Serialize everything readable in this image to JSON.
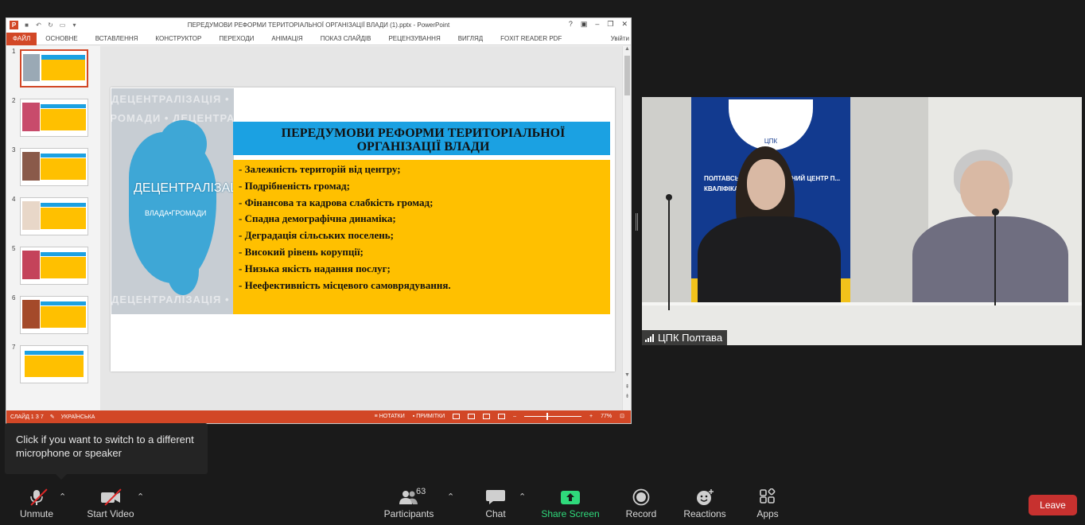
{
  "powerpoint": {
    "window_title": "ПЕРЕДУМОВИ РЕФОРМИ ТЕРИТОРІАЛЬНОЇ ОРГАНІЗАЦІЇ ВЛАДИ (1).pptx - PowerPoint",
    "window_controls": [
      "?",
      "▣",
      "–",
      "❐",
      "✕"
    ],
    "ribbon_tabs": [
      "ФАЙЛ",
      "ОСНОВНЕ",
      "ВСТАВЛЕННЯ",
      "КОНСТРУКТОР",
      "ПЕРЕХОДИ",
      "АНІМАЦІЯ",
      "ПОКАЗ СЛАЙДІВ",
      "РЕЦЕНЗУВАННЯ",
      "ВИГЛЯД",
      "FOXIT READER PDF"
    ],
    "sign_in": "Увійти",
    "thumbnails": [
      "1",
      "2",
      "3",
      "4",
      "5",
      "6",
      "7"
    ],
    "active_slide": 1,
    "slide": {
      "image_text": "ДЕЦЕНТРАЛІЗАЦІЯ",
      "image_subtext": "ВЛАДА•ГРОМАДИ",
      "title": "ПЕРЕДУМОВИ РЕФОРМИ ТЕРИТОРІАЛЬНОЇ ОРГАНІЗАЦІЇ ВЛАДИ",
      "bullets": [
        "- Залежність територій від центру;",
        "- Подрібненість громад;",
        "- Фінансова та кадрова слабкість громад;",
        "- Спадна демографічна динаміка;",
        "- Деградація сільських поселень;",
        "- Високий рівень корупції;",
        "- Низька якість надання послуг;",
        "- Неефективність місцевого самоврядування."
      ]
    },
    "status": {
      "slide_counter": "СЛАЙД 1 З 7",
      "language": "УКРАЇНСЬКА",
      "notes": "НОТАТКИ",
      "comments": "ПРИМІТКИ",
      "zoom": "77%"
    },
    "colors": {
      "accent": "#d24726",
      "title_band": "#1ba1e2",
      "body_fill": "#ffc000"
    }
  },
  "video": {
    "participant_name": "ЦПК Полтава",
    "emblem_text": "ЦПК",
    "banner_text": "ПОЛТАВСЬКИЙ РЕГІОНАЛЬНИЙ ЦЕНТР П... КВАЛІФІКАЦІЇ"
  },
  "tooltip": {
    "text": "Click if you want to switch to a different microphone or speaker"
  },
  "toolbar": {
    "unmute": "Unmute",
    "start_video": "Start Video",
    "participants": "Participants",
    "participants_count": "63",
    "chat": "Chat",
    "share_screen": "Share Screen",
    "record": "Record",
    "reactions": "Reactions",
    "apps": "Apps",
    "leave": "Leave",
    "colors": {
      "share": "#2fd97b",
      "leave": "#c7312f",
      "muted_slash": "#e02828"
    }
  }
}
